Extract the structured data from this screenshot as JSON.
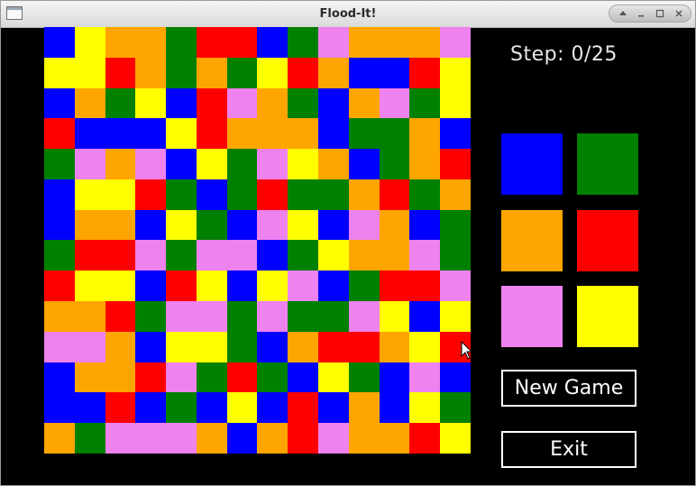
{
  "window": {
    "title": "Flood-It!"
  },
  "status": {
    "step_text": "Step: 0/25"
  },
  "palette": {
    "B": "#0000ff",
    "G": "#008000",
    "O": "#ffa500",
    "R": "#ff0000",
    "P": "#ee82ee",
    "Y": "#ffff00"
  },
  "board": [
    "BYOOGRRBGPOOOP",
    "YYROGOGYROBBRY",
    "BOGYBRPOGBOPGY",
    "RBBBYROOOBGGOB",
    "GPOPBYGPYOBGOR",
    "BYYRGBGRGGORGO",
    "BOOBYGBPYBPOBG",
    "GRRPGPPBGYOOPG",
    "RYYBRYBYPBGRRP",
    "OORGPPGPGGPYBY",
    "PPOBYYGBORROYR",
    "BOORPGRGBYGBPB",
    "BBRBGBYBRBOBYG",
    "OGPPPOBORPOORY"
  ],
  "color_buttons": [
    {
      "name": "blue-color-button",
      "color": "#0000ff"
    },
    {
      "name": "green-color-button",
      "color": "#008000"
    },
    {
      "name": "orange-color-button",
      "color": "#ffa500"
    },
    {
      "name": "red-color-button",
      "color": "#ff0000"
    },
    {
      "name": "pink-color-button",
      "color": "#ee82ee"
    },
    {
      "name": "yellow-color-button",
      "color": "#ffff00"
    }
  ],
  "actions": {
    "new_game": "New Game",
    "exit": "Exit"
  }
}
